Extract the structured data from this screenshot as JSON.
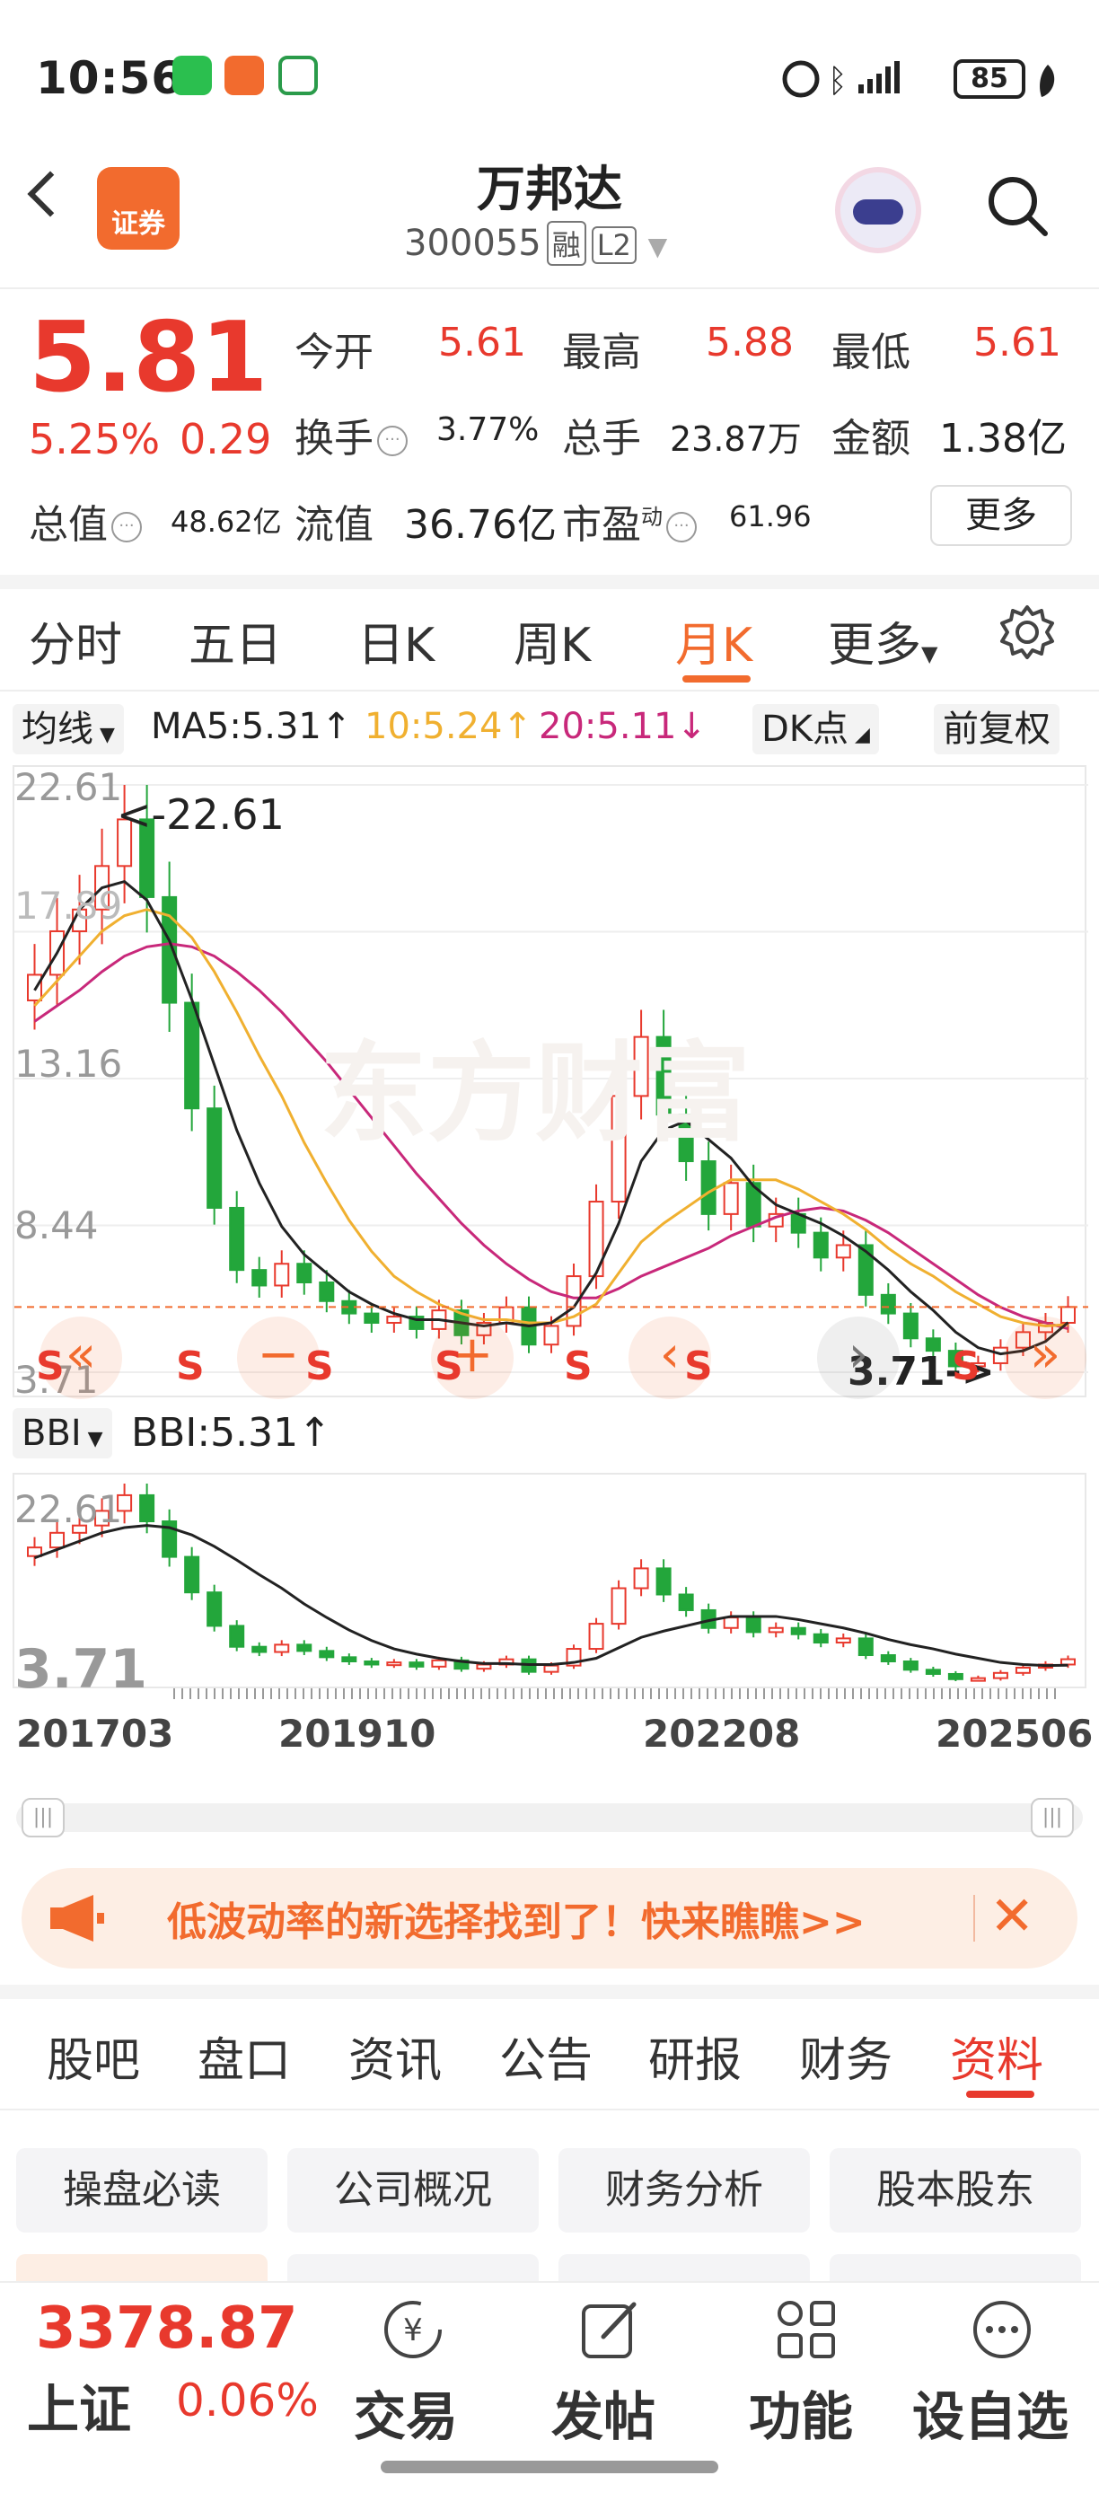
{
  "status_bar": {
    "time": "10:56",
    "battery": "85"
  },
  "header": {
    "back": "‹",
    "logo_text": "证券",
    "stock_name": "万邦达",
    "stock_code": "300055",
    "tag_margin": "融",
    "tag_level": "L2"
  },
  "quote": {
    "price": "5.81",
    "change_pct": "5.25%",
    "change": "0.29",
    "open_label": "今开",
    "open": "5.61",
    "high_label": "最高",
    "high": "5.88",
    "low_label": "最低",
    "low": "5.61",
    "turnover_label": "换手",
    "turnover": "3.77%",
    "volume_label": "总手",
    "volume": "23.87万",
    "amount_label": "金额",
    "amount": "1.38亿",
    "mcap_label": "总值",
    "mcap": "48.62亿",
    "float_label": "流值",
    "float_mcap": "36.76亿",
    "pe_label": "市盈",
    "pe_sup": "动",
    "pe": "61.96",
    "more": "更多"
  },
  "period_tabs": [
    {
      "label": "分时"
    },
    {
      "label": "五日"
    },
    {
      "label": "日K"
    },
    {
      "label": "周K"
    },
    {
      "label": "月K"
    },
    {
      "label": "更多"
    }
  ],
  "ma_bar": {
    "ma_select": "均线",
    "ma5": "MA5:5.31↑",
    "ma10": "10:5.24↑",
    "ma20": "20:5.11↓",
    "dk": "DK点",
    "adjust": "前复权",
    "ma5_color": "#222222",
    "ma10_color": "#f0b030",
    "ma20_color": "#c8287a"
  },
  "chart_data": [
    {
      "type": "candlestick",
      "title": "月K",
      "y_ticks": [
        "22.61",
        "17.89",
        "13.16",
        "8.44",
        "3.71"
      ],
      "ylim": [
        3.71,
        22.61
      ],
      "max_label": "<-22.61",
      "min_label": "3.71->",
      "signal_labels": [
        "S",
        "S",
        "S",
        "S",
        "S",
        "S",
        "S"
      ],
      "watermark": "东方财富",
      "up_color": "#e8392d",
      "down_color": "#23a63b",
      "close": [
        16.5,
        17.9,
        18.6,
        20.0,
        21.5,
        19.0,
        15.6,
        12.2,
        9.0,
        7.0,
        6.5,
        7.2,
        6.6,
        6.0,
        5.6,
        5.3,
        5.5,
        5.1,
        5.7,
        4.9,
        5.3,
        5.8,
        4.6,
        5.2,
        6.8,
        9.2,
        12.6,
        14.5,
        12.0,
        10.5,
        8.8,
        9.8,
        8.4,
        8.8,
        8.2,
        7.4,
        7.8,
        6.2,
        5.6,
        4.8,
        4.4,
        3.9,
        4.0,
        4.5,
        5.0,
        5.3,
        5.81
      ],
      "ma5": [
        16.0,
        17.2,
        18.6,
        19.3,
        19.5,
        18.9,
        17.6,
        15.7,
        13.6,
        11.5,
        9.8,
        8.4,
        7.5,
        6.9,
        6.3,
        5.9,
        5.6,
        5.4,
        5.4,
        5.3,
        5.2,
        5.3,
        5.2,
        5.3,
        5.8,
        6.9,
        8.5,
        10.5,
        11.5,
        11.8,
        11.2,
        10.6,
        9.7,
        9.1,
        8.8,
        8.5,
        8.1,
        7.6,
        7.0,
        6.3,
        5.7,
        5.0,
        4.5,
        4.3,
        4.4,
        4.7,
        5.31
      ],
      "ma10": [
        15.5,
        16.3,
        17.1,
        17.9,
        18.4,
        18.6,
        18.4,
        17.7,
        16.6,
        15.3,
        13.9,
        12.6,
        11.1,
        9.8,
        8.6,
        7.6,
        6.8,
        6.3,
        5.9,
        5.6,
        5.4,
        5.4,
        5.3,
        5.3,
        5.5,
        5.9,
        6.9,
        7.9,
        8.5,
        9.0,
        9.5,
        9.9,
        9.9,
        9.9,
        9.6,
        9.2,
        8.8,
        8.3,
        7.7,
        7.2,
        6.8,
        6.3,
        5.9,
        5.5,
        5.3,
        5.2,
        5.24
      ],
      "ma20": [
        15.0,
        15.5,
        16.0,
        16.6,
        17.1,
        17.4,
        17.5,
        17.4,
        17.1,
        16.6,
        16.0,
        15.3,
        14.5,
        13.7,
        12.8,
        11.9,
        11.0,
        10.1,
        9.3,
        8.5,
        7.8,
        7.2,
        6.7,
        6.3,
        6.1,
        6.1,
        6.4,
        6.8,
        7.1,
        7.4,
        7.7,
        8.1,
        8.4,
        8.7,
        8.9,
        9.0,
        8.9,
        8.6,
        8.2,
        7.7,
        7.2,
        6.7,
        6.2,
        5.8,
        5.5,
        5.3,
        5.11
      ]
    },
    {
      "type": "candlestick",
      "title": "BBI",
      "indicator_select": "BBI",
      "indicator_value": "BBI:5.31↑",
      "y_ticks": [
        "22.61",
        "3.71"
      ],
      "ylim": [
        3.71,
        22.61
      ],
      "x_ticks": [
        "201703",
        "201910",
        "202208",
        "202506"
      ]
    }
  ],
  "chart_nav": {
    "left": "«",
    "minus": "−",
    "plus": "+",
    "prev": "‹",
    "next": "›",
    "right": "»"
  },
  "banner": {
    "text": "低波动率的新选择找到了！快来瞧瞧>>",
    "close": "✕"
  },
  "bottom_tabs": [
    {
      "label": "股吧"
    },
    {
      "label": "盘口"
    },
    {
      "label": "资讯"
    },
    {
      "label": "公告"
    },
    {
      "label": "研报"
    },
    {
      "label": "财务"
    },
    {
      "label": "资料"
    }
  ],
  "cards": [
    {
      "label": "操盘必读"
    },
    {
      "label": "公司概况"
    },
    {
      "label": "财务分析"
    },
    {
      "label": "股本股东"
    }
  ],
  "bottom_bar": {
    "index_value": "3378.87",
    "index_name": "上证",
    "index_pct": "0.06%",
    "items": [
      {
        "label": "交易"
      },
      {
        "label": "发帖"
      },
      {
        "label": "功能"
      },
      {
        "label": "设自选"
      }
    ]
  }
}
